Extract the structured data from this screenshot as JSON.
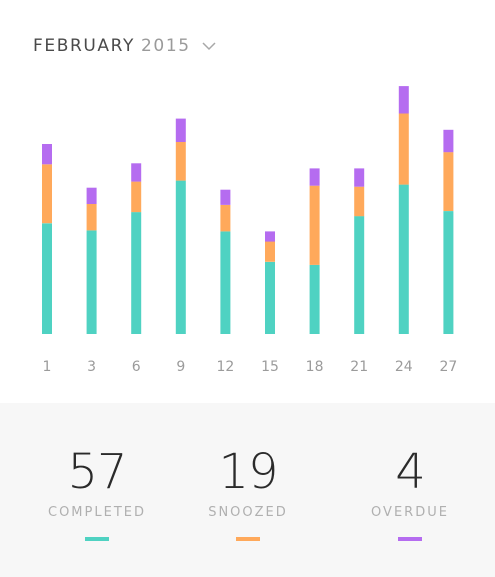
{
  "header": {
    "month": "FEBRUARY",
    "year": "2015",
    "dropdown_icon": "chevron-down-icon"
  },
  "colors": {
    "completed": "#4fd2c2",
    "snoozed": "#ffa95b",
    "overdue": "#b56cf0",
    "tick_text": "#9b9b9b"
  },
  "chart_data": {
    "type": "bar",
    "stacked": true,
    "categories": [
      "1",
      "3",
      "6",
      "9",
      "12",
      "15",
      "18",
      "21",
      "24",
      "27"
    ],
    "series": [
      {
        "name": "COMPLETED",
        "values": [
          109,
          102,
          120,
          151,
          101,
          71,
          68,
          116,
          147,
          121
        ]
      },
      {
        "name": "SNOOZED",
        "values": [
          58,
          26,
          30,
          38,
          26,
          20,
          78,
          29,
          70,
          58
        ]
      },
      {
        "name": "OVERDUE",
        "values": [
          20,
          16,
          18,
          23,
          15,
          10,
          17,
          18,
          27,
          22
        ]
      }
    ],
    "ylim": [
      0,
      250
    ],
    "grid": false,
    "legend": "bottom"
  },
  "stats": [
    {
      "value": "57",
      "label": "COMPLETED"
    },
    {
      "value": "19",
      "label": "SNOOZED"
    },
    {
      "value": "4",
      "label": "OVERDUE"
    }
  ]
}
